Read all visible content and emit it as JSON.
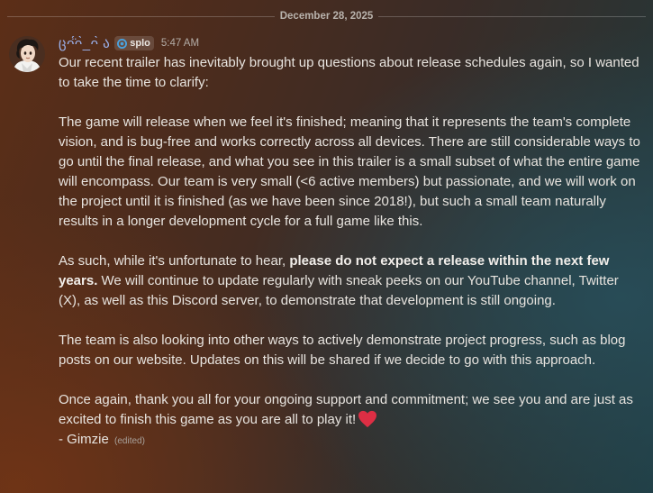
{
  "divider": {
    "date": "December 28, 2025"
  },
  "message": {
    "username": "ცᴖ̈́ᴖ̀_ᴖ̀ ა",
    "tag": "splo",
    "timestamp": "5:47 AM",
    "paragraphs": [
      {
        "text": "Our recent trailer has inevitably brought up questions about release schedules again, so I wanted to take the time to clarify:"
      },
      {
        "text": "The game will release when we feel it's finished; meaning that it represents the team's complete vision, and is bug-free and works correctly across all devices. There are still considerable ways to go until the final release, and what you see in this trailer is a small subset of what the entire game will encompass. Our team is very small (<6 active members) but passionate, and we will work on the project until it is finished (as we have been since 2018!), but such a small team naturally results in a longer development cycle for a full game like this."
      },
      {
        "before": "As such, while it's unfortunate to hear, ",
        "bold": "please do not expect a release within the next few years.",
        "after": " We will continue to update regularly with sneak peeks on our YouTube channel, Twitter (X), as well as this Discord server, to demonstrate that development is still ongoing."
      },
      {
        "text": "The team is also looking into other ways to actively demonstrate project progress, such as blog posts on our website. Updates on this will be shared if we decide to go with this approach."
      },
      {
        "text": "Once again, thank you all for your ongoing support and commitment; we see you and are just as excited to finish this game as you are all to play it!",
        "signature": "- Gimzie",
        "edited": "(edited)"
      }
    ]
  },
  "colors": {
    "username": "#9cb4f0",
    "heart": "#dd2e44",
    "tag_icon": "#4aa3df"
  },
  "icons": {
    "tag": "splo-tag-icon",
    "heart": "heart-icon",
    "avatar": "avatar"
  }
}
